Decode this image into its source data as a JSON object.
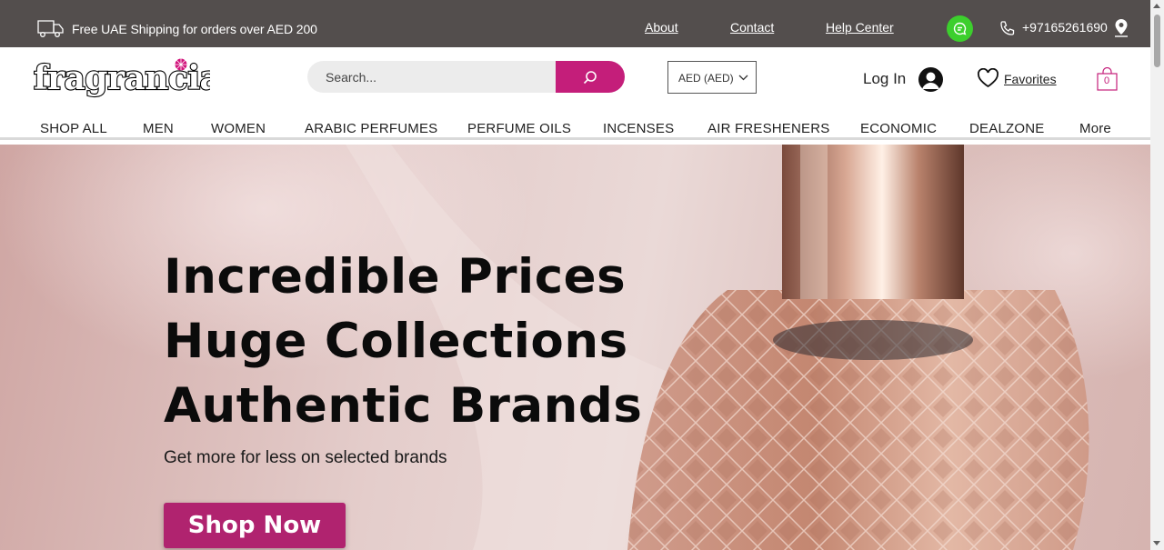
{
  "topbar": {
    "shipping_text": "Free UAE Shipping for orders over AED 200",
    "links": [
      "About",
      "Contact",
      "Help Center"
    ],
    "phone": "+97165261690",
    "chat_color": "#3ccf2d"
  },
  "header": {
    "logo_text": "fragrancia",
    "search_placeholder": "Search...",
    "currency": "AED (AED)",
    "login_label": "Log In",
    "favorites_label": "Favorites",
    "cart_count": "0",
    "accent_color": "#c41e7a"
  },
  "nav": {
    "items": [
      "SHOP ALL",
      "MEN",
      "WOMEN",
      "ARABIC PERFUMES",
      "PERFUME OILS",
      "INCENSES",
      "AIR FRESHENERS",
      "ECONOMIC",
      "DEALZONE",
      "More"
    ]
  },
  "hero": {
    "line1": "Incredible Prices",
    "line2": "Huge Collections",
    "line3": "Authentic Brands",
    "subtitle": "Get more for less on selected brands",
    "cta": "Shop Now"
  },
  "icons": [
    "truck-icon",
    "chat-icon",
    "phone-icon",
    "location-pin-icon",
    "search-icon",
    "chevron-down-icon",
    "user-avatar-icon",
    "heart-icon",
    "shopping-bag-icon"
  ]
}
